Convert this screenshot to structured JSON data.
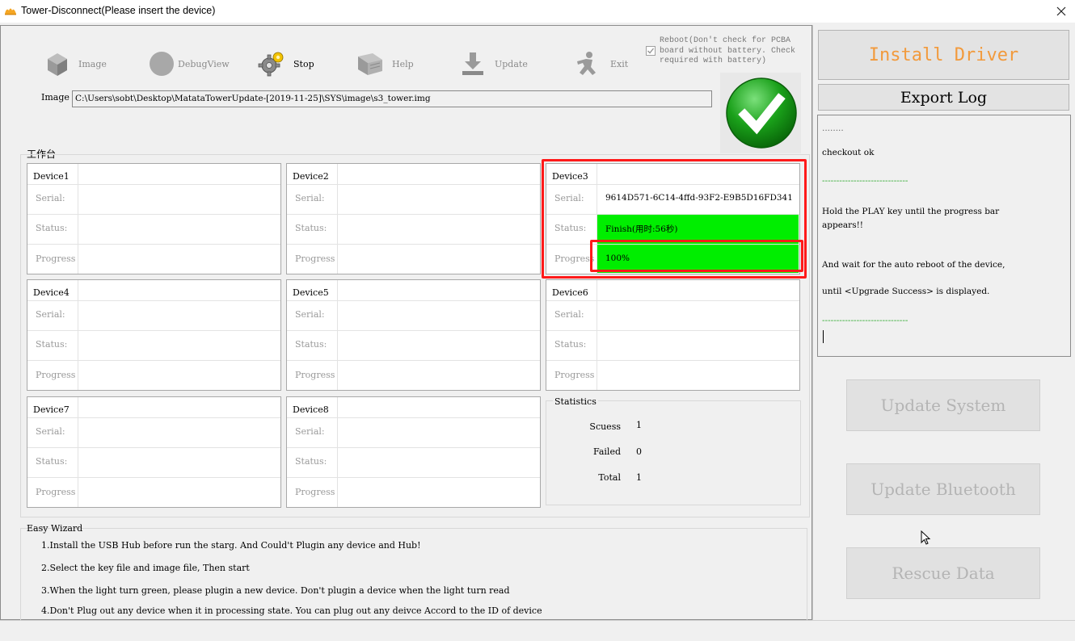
{
  "window": {
    "title": "Tower-Disconnect(Please insert the device)"
  },
  "toolbar": {
    "image": "Image",
    "debugview": "DebugView",
    "stop": "Stop",
    "help": "Help",
    "update": "Update",
    "exit": "Exit"
  },
  "reboot": {
    "label": "Reboot(Don't check for PCBA board without battery. Check required with battery)",
    "checked": true
  },
  "image": {
    "label": "Image",
    "path": "C:\\Users\\sobt\\Desktop\\MatataTowerUpdate-[2019-11-25]\\SYS\\image\\s3_tower.img"
  },
  "workbench": {
    "label": "工作台",
    "field_labels": {
      "serial": "Serial:",
      "status": "Status:",
      "progress": "Progress"
    },
    "devices": [
      {
        "name": "Device1",
        "serial": "",
        "status": "",
        "progress": ""
      },
      {
        "name": "Device2",
        "serial": "",
        "status": "",
        "progress": ""
      },
      {
        "name": "Device3",
        "serial": "9614D571-6C14-4ffd-93F2-E9B5D16FD341",
        "status": "Finish(用时:56秒)",
        "progress": "100%",
        "progress_fraction": 1.0
      },
      {
        "name": "Device4",
        "serial": "",
        "status": "",
        "progress": ""
      },
      {
        "name": "Device5",
        "serial": "",
        "status": "",
        "progress": ""
      },
      {
        "name": "Device6",
        "serial": "",
        "status": "",
        "progress": ""
      },
      {
        "name": "Device7",
        "serial": "",
        "status": "",
        "progress": ""
      },
      {
        "name": "Device8",
        "serial": "",
        "status": "",
        "progress": ""
      }
    ]
  },
  "statistics": {
    "title": "Statistics",
    "scuess_label": "Scuess",
    "scuess": "1",
    "failed_label": "Failed",
    "failed": "0",
    "total_label": "Total",
    "total": "1"
  },
  "wizard": {
    "title": "Easy Wizard",
    "steps": [
      "1.Install the USB Hub before run the starg. And Could't Plugin any device and Hub!",
      "2.Select the key file and image file, Then start",
      "3.When the light turn green, please plugin a new device. Don't plugin a device when the light turn read",
      "4.Don't Plug out any device when it in processing state. You can plug out any deivce Accord to the ID of device"
    ]
  },
  "right": {
    "install_driver": "Install Driver",
    "export_log": "Export Log",
    "update_system": "Update System",
    "update_bluetooth": "Update Bluetooth",
    "rescue_data": "Rescue Data"
  },
  "log": {
    "lines": [
      "........",
      "checkout ok",
      "------------------------------",
      "Hold the PLAY key until the progress bar",
      "appears!!",
      "And wait for the auto reboot of the device,",
      "until <Upgrade Success> is displayed.",
      "------------------------------"
    ]
  },
  "colors": {
    "progress_green": "#00ee00",
    "highlight_red": "#ff1a1a",
    "install_driver_orange": "#f29a3c",
    "log_separator_green": "#2aa82a"
  },
  "icons": {
    "image": "box-icon",
    "debugview": "circle-icon",
    "stop": "gear-icon",
    "help": "book-icon",
    "update": "download-arrow-icon",
    "exit": "running-man-icon",
    "status": "big-green-check-icon"
  }
}
